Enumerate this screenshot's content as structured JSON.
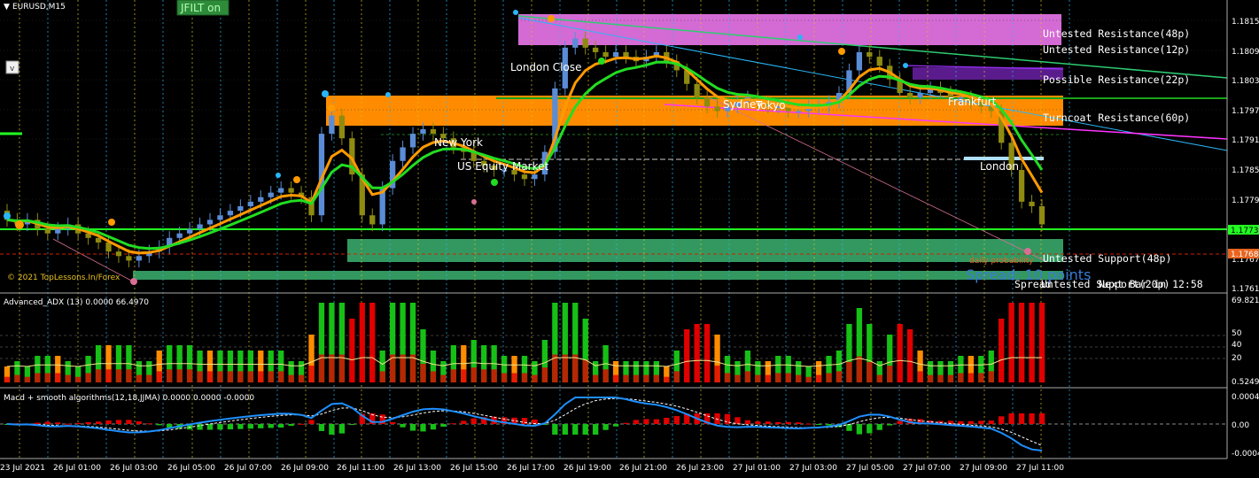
{
  "symbol": "EURUSD,M15",
  "filter_button": "JFILT on",
  "collapse_button": "v",
  "copyright": "© 2021 TopLessons.In/Forex",
  "spread_text": "Spread: 10 points",
  "spread_caption": "Spread",
  "next_bar": "Next Bar in 12:58",
  "support_over_text": "Untested Support(20p)",
  "probability_text": "daily probability",
  "colors": {
    "background": "#000000",
    "up_candle": "#5b8cd6",
    "down_candle": "#8e8b10",
    "jfilt_line": "#22dd22",
    "ma_line": "#ff9a00",
    "resistance_48": "#d46ad4",
    "resistance_22": "#5a1c8c",
    "turncoat": "#ff8c00",
    "support": "#3cb371",
    "adx_green": "#16c016",
    "adx_red": "#e00000",
    "adx_orange": "#ff8c00",
    "macd_line": "#1e90ff",
    "macd_signal": "#ffffff"
  },
  "zones": {
    "resistance48": "Untested Resistance(48p)",
    "resistance12": "Untested Resistance(12p)",
    "resistance22": "Possible Resistance(22p)",
    "turncoat60": "Turncoat Resistance(60p)",
    "support48": "Untested Support(48p)"
  },
  "sessions": {
    "london_close": "London Close",
    "new_york": "New York",
    "us_equity": "US Equity Market",
    "sydney": "Sydney",
    "tokyo": "Tokyo",
    "frankfurt": "Frankfurt",
    "london": "London"
  },
  "price_axis": {
    "labels": [
      "1.18155",
      "1.18097",
      "1.18039",
      "1.17970",
      "1.17912",
      "1.17854",
      "1.17796"
    ],
    "bottom_labels": [
      "1.17678",
      "1.17619"
    ],
    "current_price": "1.17737",
    "red_price": "1.17684"
  },
  "time_axis": [
    "23 Jul 2021",
    "26 Jul 01:00",
    "26 Jul 03:00",
    "26 Jul 05:00",
    "26 Jul 07:00",
    "26 Jul 09:00",
    "26 Jul 11:00",
    "26 Jul 13:00",
    "26 Jul 15:00",
    "26 Jul 17:00",
    "26 Jul 19:00",
    "26 Jul 21:00",
    "26 Jul 23:00",
    "27 Jul 01:00",
    "27 Jul 03:00",
    "27 Jul 05:00",
    "27 Jul 07:00",
    "27 Jul 09:00",
    "27 Jul 11:00"
  ],
  "adx_panel": {
    "title": "Advanced_ADX (13) 0.0000 66.4970",
    "axis_labels": [
      "69.8218",
      "50",
      "40",
      "20",
      "0.5249"
    ]
  },
  "macd_panel": {
    "title": "Macd + smooth algorithms(12,18,JJMA) 0.0000 0.0000 -0.0000",
    "axis_labels": [
      "0.0004",
      "0.00",
      "-0.0004"
    ]
  },
  "chart_data": {
    "type": "candlestick",
    "ylim": [
      1.1761,
      1.182
    ],
    "closes": [
      1.1775,
      1.1774,
      1.1775,
      1.1773,
      1.1772,
      1.1773,
      1.1774,
      1.1772,
      1.1771,
      1.177,
      1.1768,
      1.1767,
      1.1766,
      1.1767,
      1.1768,
      1.1769,
      1.1771,
      1.1772,
      1.1773,
      1.1774,
      1.1775,
      1.1776,
      1.1777,
      1.1778,
      1.1779,
      1.178,
      1.1781,
      1.1782,
      1.1781,
      1.178,
      1.1776,
      1.1794,
      1.1798,
      1.1793,
      1.1785,
      1.1776,
      1.1774,
      1.1782,
      1.1788,
      1.1791,
      1.1794,
      1.1795,
      1.1794,
      1.1793,
      1.1791,
      1.179,
      1.1788,
      1.1787,
      1.1786,
      1.1786,
      1.1785,
      1.1784,
      1.1785,
      1.179,
      1.1804,
      1.1813,
      1.1815,
      1.1813,
      1.1812,
      1.1811,
      1.1812,
      1.1811,
      1.181,
      1.1811,
      1.1812,
      1.181,
      1.1808,
      1.1805,
      1.1802,
      1.18,
      1.1799,
      1.18,
      1.1801,
      1.1802,
      1.1801,
      1.18,
      1.18,
      1.1799,
      1.1799,
      1.18,
      1.18,
      1.1801,
      1.1803,
      1.1808,
      1.1812,
      1.1811,
      1.1809,
      1.1806,
      1.1803,
      1.1802,
      1.1803,
      1.1804,
      1.1803,
      1.1802,
      1.1802,
      1.1801,
      1.18,
      1.1799,
      1.1792,
      1.1786,
      1.1779,
      1.1778,
      1.1774
    ]
  }
}
